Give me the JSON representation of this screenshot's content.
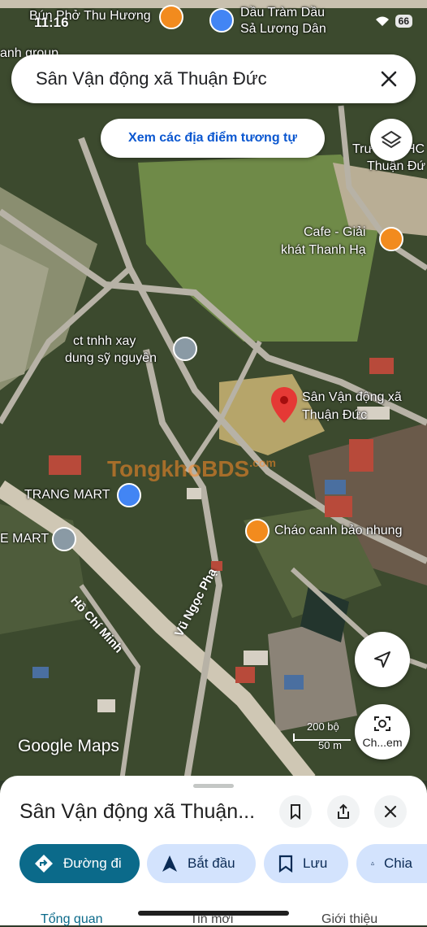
{
  "status_bar": {
    "time": "11:16",
    "battery": "66"
  },
  "search": {
    "query": "Sân Vận động xã Thuận Đức"
  },
  "similar_places_label": "Xem các địa điểm tương tự",
  "map_labels": {
    "top_left": "Bún Phở Thu Hương",
    "top_right_line1": "Dầu Tràm Dầu",
    "top_right_line2": "Sả Lương Dân",
    "left_edge": "anh group",
    "school_line1": "Trư",
    "school_line1b": "HC",
    "school_line2": "Thuận Đứ",
    "cafe_line1": "Cafe - Giải",
    "cafe_line2": "khát Thanh Hạ",
    "company_line1": "ct tnhh xay",
    "company_line2": "dung sỹ nguyên",
    "stadium_line1": "Sân Vận động xã",
    "stadium_line2": "Thuận Đức",
    "trang_mart": "TRANG MART",
    "e_mart": "E MART",
    "chao": "Cháo canh bảo nhung",
    "road_hcm": "Hồ Chí Minh",
    "road_vnp": "Vũ Ngọc Phạ",
    "watermark": "TongkhoBDS",
    "watermark_com": ".com"
  },
  "map_footer": {
    "attribution": "Google Maps",
    "scale_top": "200 bộ",
    "scale_bottom": "50 m",
    "ch_label": "Ch...em"
  },
  "sheet": {
    "title": "Sân Vận động xã Thuận...",
    "chips": [
      {
        "label": "Đường đi"
      },
      {
        "label": "Bắt đầu"
      },
      {
        "label": "Lưu"
      },
      {
        "label": "Chia"
      }
    ],
    "tabs": [
      {
        "label": "Tổng quan"
      },
      {
        "label": "Tin mới"
      },
      {
        "label": "Giới thiệu"
      }
    ]
  },
  "colors": {
    "pin_red": "#e53935",
    "restaurant_orange": "#f28b1e",
    "place_grey": "#8a9aa5",
    "shop_blue": "#4285f4",
    "primary_teal": "#0b6a8a"
  }
}
